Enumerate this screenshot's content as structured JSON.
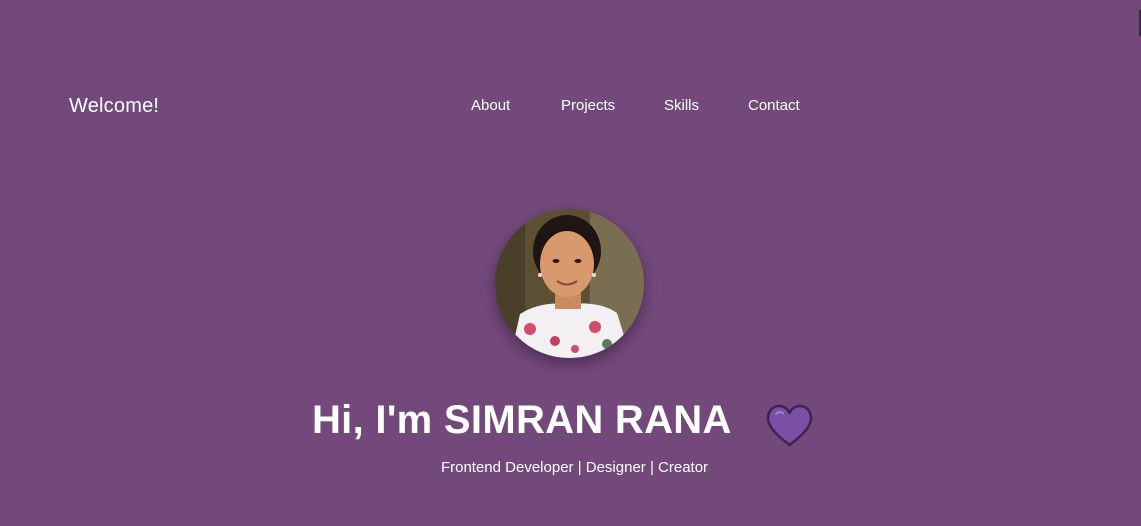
{
  "header": {
    "brand": "Welcome!",
    "nav": [
      {
        "label": "About"
      },
      {
        "label": "Projects"
      },
      {
        "label": "Skills"
      },
      {
        "label": "Contact"
      }
    ]
  },
  "hero": {
    "title": "Hi, I'm SIMRAN RANA",
    "tagline": "Frontend Developer | Designer | Creator",
    "avatar_icon": "profile-photo",
    "heart_icon": "purple-heart-icon"
  },
  "colors": {
    "background": "#72497a",
    "text": "#ffffff",
    "heart": "#7c4fa6"
  }
}
